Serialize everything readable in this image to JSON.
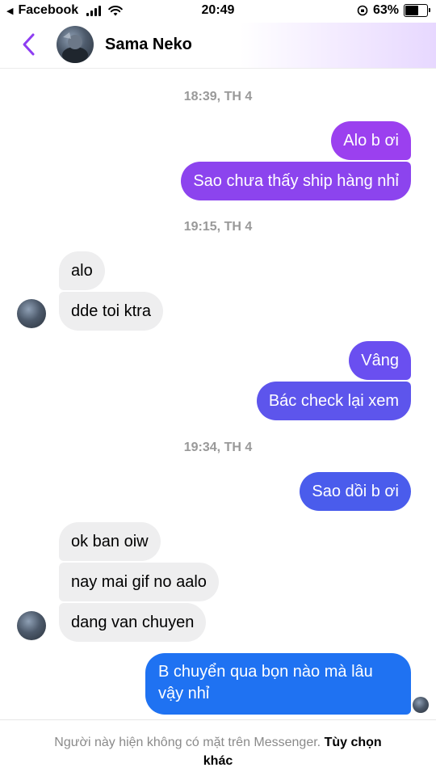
{
  "status_bar": {
    "back_app": "Facebook",
    "time": "20:49",
    "battery": "63%",
    "battery_level": 0.63
  },
  "header": {
    "contact_name": "Sama Neko"
  },
  "conversation": {
    "timestamp_1": "18:39, TH 4",
    "msg_1": "Alo b ơi",
    "msg_2": "Sao chưa thấy ship hàng nhỉ",
    "timestamp_2": "19:15, TH 4",
    "msg_3": "alo",
    "msg_4": "dde toi ktra",
    "msg_5": "Vâng",
    "msg_6": "Bác check lại xem",
    "timestamp_3": "19:34, TH 4",
    "msg_7": "Sao dồi b ơi",
    "msg_8": "ok ban oiw",
    "msg_9": "nay mai gif no aalo",
    "msg_10": "dang van chuyen",
    "msg_11_line1": "B chuyển qua bọn nào mà lâu",
    "msg_11_line2": "vậy nhỉ"
  },
  "footer": {
    "notice": "Người này hiện không có mặt trên Messenger.",
    "link": "Tùy chọn khác"
  },
  "colors": {
    "outgoing_top": "#9d3ff0",
    "outgoing_mid": "#5a55e8",
    "outgoing_bottom": "#1f72f2",
    "incoming": "#eeeeef",
    "back_arrow": "#8e3df2"
  }
}
